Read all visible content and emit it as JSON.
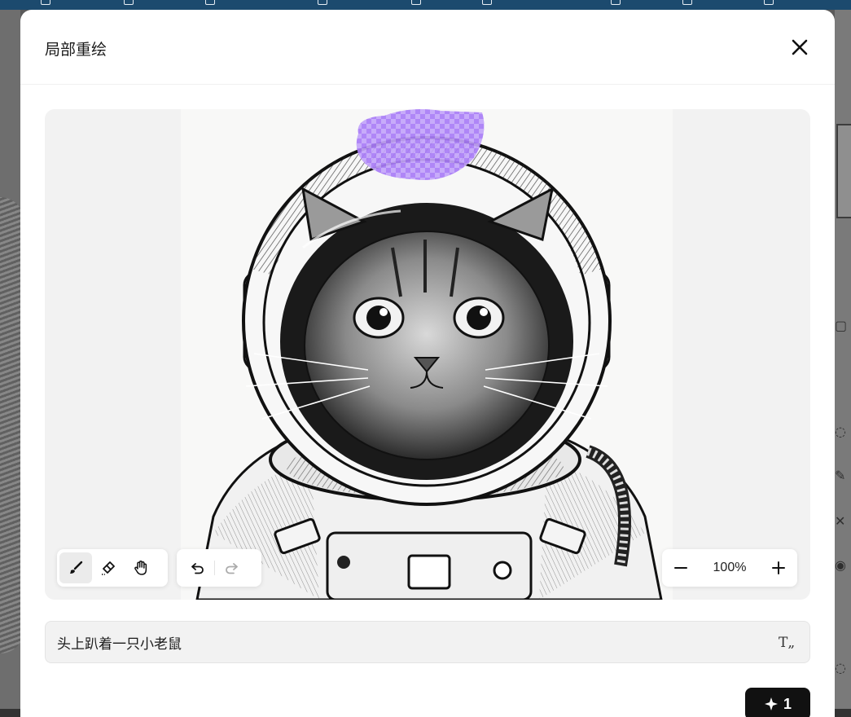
{
  "modal": {
    "title": "局部重绘"
  },
  "canvas": {
    "subject": "cat-in-astronaut-helmet-sketch"
  },
  "toolbar": {
    "tools": [
      {
        "name": "brush",
        "icon": "brush-icon",
        "active": true
      },
      {
        "name": "eraser",
        "icon": "eraser-icon",
        "active": false
      },
      {
        "name": "pan",
        "icon": "hand-icon",
        "active": false
      }
    ],
    "undo_icon": "undo-icon",
    "redo_icon": "redo-icon"
  },
  "zoom": {
    "value": "100%",
    "minus_icon": "minus-icon",
    "plus_icon": "plus-icon"
  },
  "prompt": {
    "value": "头上趴着一只小老鼠",
    "text_style_label": "T„"
  },
  "generate": {
    "icon": "sparkle-icon",
    "count": "1"
  },
  "colors": {
    "mask": "#9b6cf5",
    "accent": "#111111"
  }
}
